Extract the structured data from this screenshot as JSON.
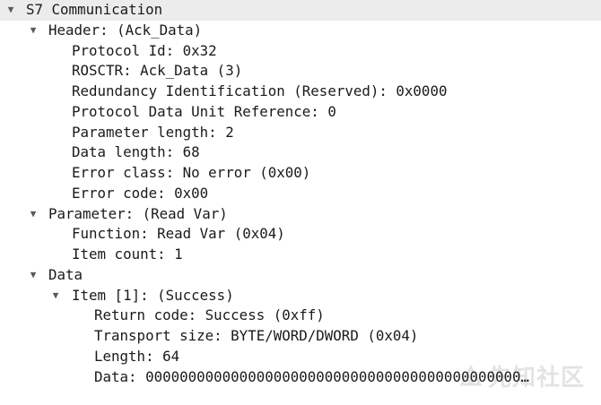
{
  "tree": {
    "root": {
      "label": "S7 Communication",
      "toggle": "▼"
    },
    "header": {
      "label": "Header: (Ack_Data)",
      "toggle": "▼",
      "fields": [
        "Protocol Id: 0x32",
        "ROSCTR: Ack_Data (3)",
        "Redundancy Identification (Reserved): 0x0000",
        "Protocol Data Unit Reference: 0",
        "Parameter length: 2",
        "Data length: 68",
        "Error class: No error (0x00)",
        "Error code: 0x00"
      ]
    },
    "parameter": {
      "label": "Parameter: (Read Var)",
      "toggle": "▼",
      "fields": [
        "Function: Read Var (0x04)",
        "Item count: 1"
      ]
    },
    "data": {
      "label": "Data",
      "toggle": "▼",
      "item": {
        "label": "Item [1]: (Success)",
        "toggle": "▼",
        "fields": [
          "Return code: Success (0xff)",
          "Transport size: BYTE/WORD/DWORD (0x04)",
          "Length: 64",
          "Data: 00000000000000000000000000000000000000000000000000…"
        ]
      }
    }
  },
  "watermark": {
    "text": "先知社区"
  },
  "colors": {
    "top_row_bg": "#ececec",
    "text": "#1a1a1a",
    "toggle": "#5a5a5a"
  }
}
